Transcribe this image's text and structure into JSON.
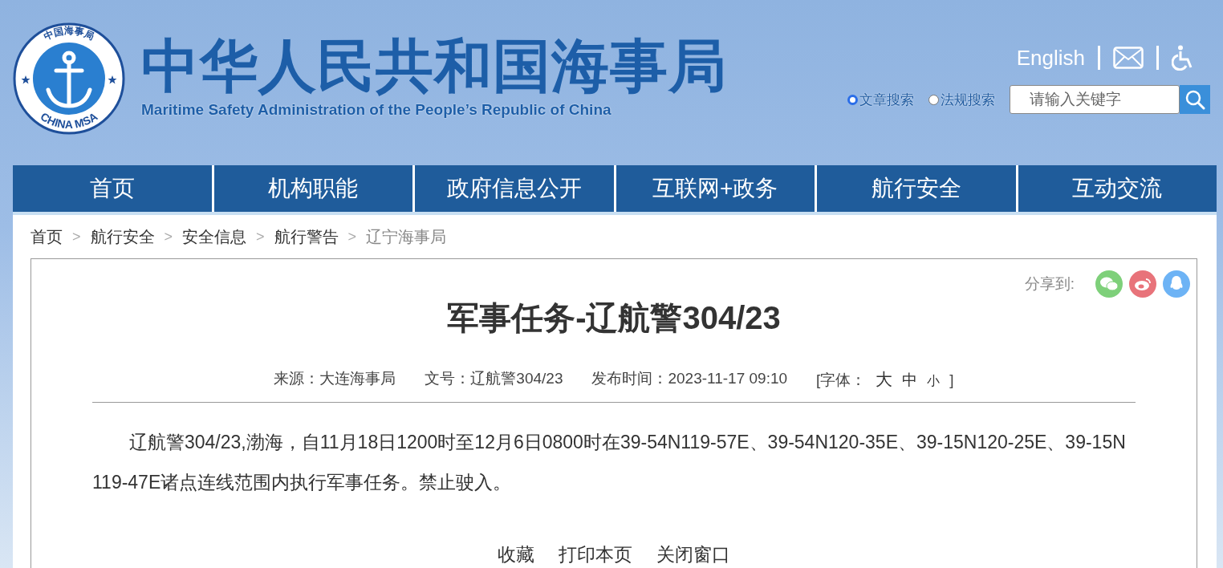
{
  "header": {
    "logo_cn": "中国海事局",
    "logo_en": "CHINA MSA",
    "title": "中华人民共和国海事局",
    "subtitle": "Maritime Safety Administration of the People’s Republic of China",
    "english_link": "English",
    "search_scopes": [
      {
        "label": "文章搜索",
        "selected": true
      },
      {
        "label": "法规搜索",
        "selected": false
      }
    ],
    "search": {
      "placeholder": "请输入关键字"
    }
  },
  "nav": [
    {
      "label": "首页"
    },
    {
      "label": "机构职能"
    },
    {
      "label": "政府信息公开"
    },
    {
      "label": "互联网+政务"
    },
    {
      "label": "航行安全"
    },
    {
      "label": "互动交流"
    }
  ],
  "breadcrumb": [
    {
      "label": "首页",
      "current": false
    },
    {
      "label": "航行安全",
      "current": false
    },
    {
      "label": "安全信息",
      "current": false
    },
    {
      "label": "航行警告",
      "current": false
    },
    {
      "label": "辽宁海事局",
      "current": true
    }
  ],
  "breadcrumb_separator": ">",
  "article": {
    "share_label": "分享到:",
    "share": [
      {
        "kind": "wechat",
        "color": "#7ed07a"
      },
      {
        "kind": "weibo",
        "color": "#e8737a"
      },
      {
        "kind": "qq",
        "color": "#6db3f5"
      }
    ],
    "title": "军事任务-辽航警304/23",
    "meta": [
      "来源：大连海事局",
      "文号：辽航警304/23",
      "发布时间：2023-11-17 09:10"
    ],
    "font_size": {
      "label": "[字体：",
      "sizes": [
        "大",
        "中",
        "小"
      ],
      "close": "]"
    },
    "body": "辽航警304/23,渤海，自11月18日1200时至12月6日0800时在39-54N119-57E、39-54N120-35E、39-15N120-25E、39-15N119-47E诸点连线范围内执行军事任务。禁止驶入。",
    "actions": [
      "收藏",
      "打印本页",
      "关闭窗口"
    ]
  }
}
